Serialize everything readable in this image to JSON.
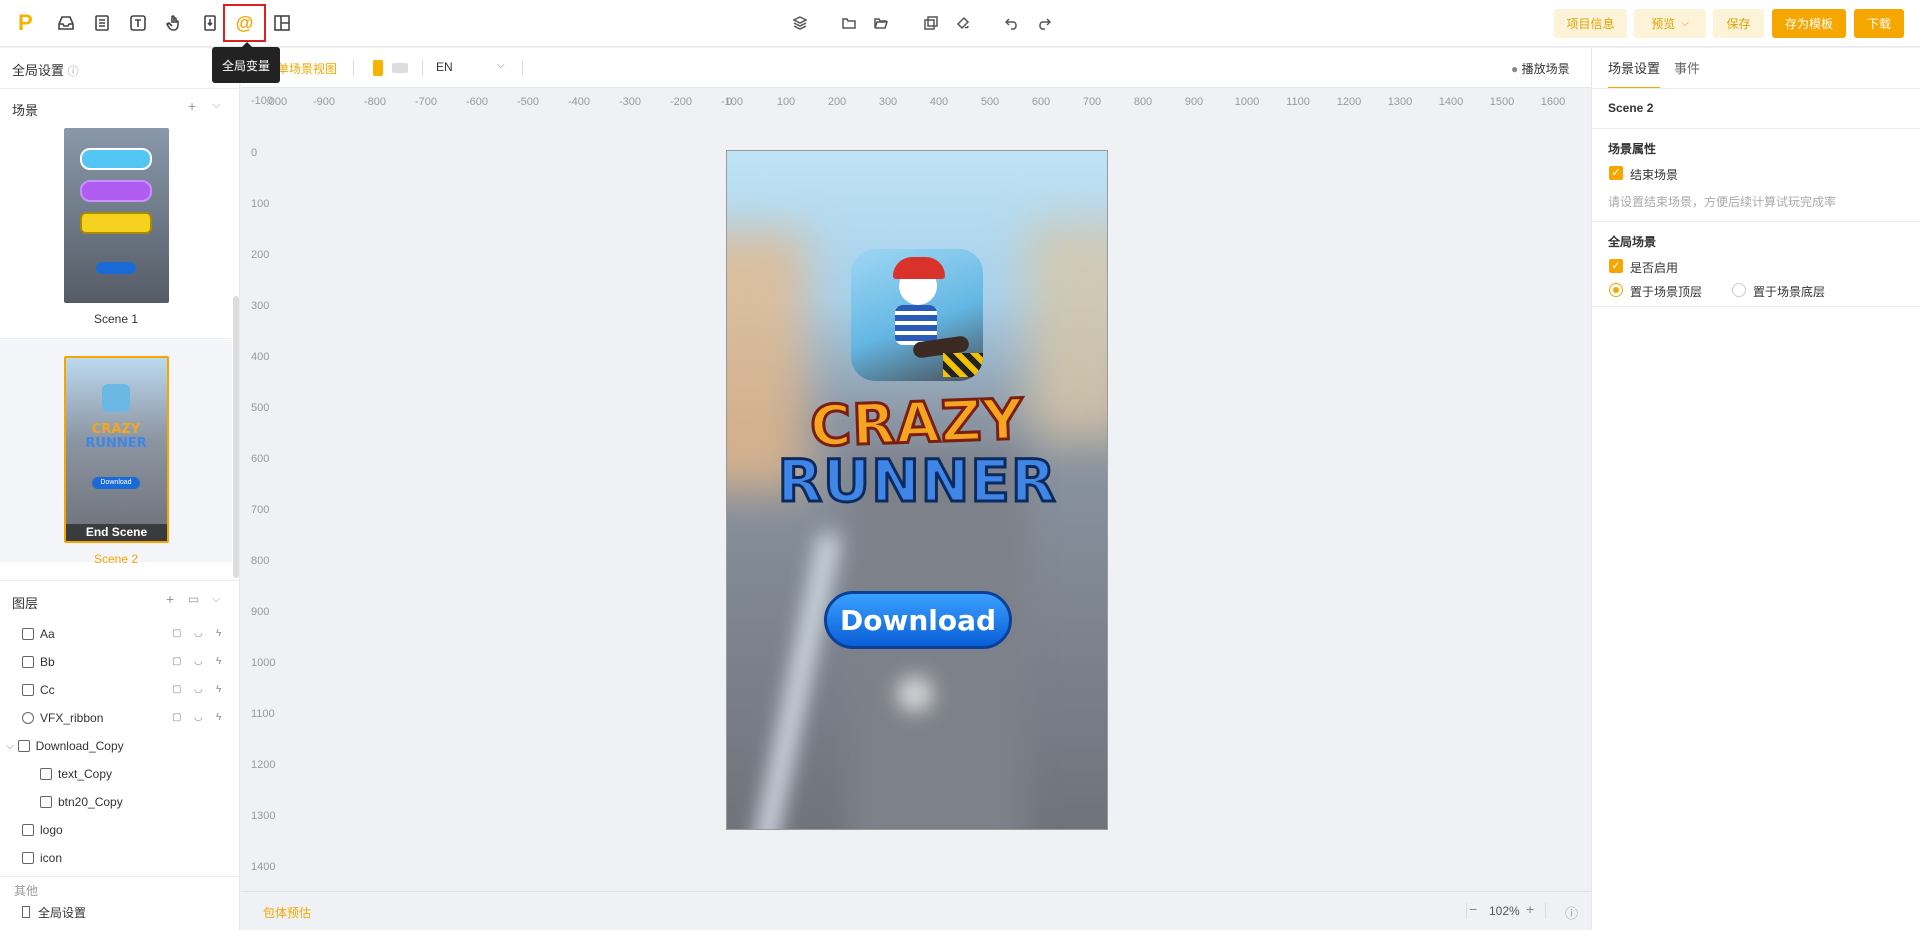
{
  "topbar": {
    "logo": "P",
    "active_icon_glyph": "@",
    "tooltip": "全局变量",
    "buttons": {
      "project_info": "项目信息",
      "preview": "预览",
      "save": "保存",
      "save_template": "存为模板",
      "download": "下载"
    }
  },
  "left": {
    "global_settings": "全局设置",
    "scenes_header": "场景",
    "scenes": [
      {
        "label": "Scene 1"
      },
      {
        "label": "Scene 2",
        "thumb_tag": "End Scene",
        "thumb_btn": "Download"
      }
    ],
    "layers_header": "图层",
    "layers": [
      {
        "name": "Aa"
      },
      {
        "name": "Bb"
      },
      {
        "name": "Cc"
      },
      {
        "name": "VFX_ribbon"
      },
      {
        "name": "Download_Copy"
      },
      {
        "name": "text_Copy"
      },
      {
        "name": "btn20_Copy"
      },
      {
        "name": "logo"
      },
      {
        "name": "icon"
      }
    ],
    "other_header": "其他",
    "other_item": "全局设置"
  },
  "subbar": {
    "single_scene_view": "单场景视图",
    "language": "EN",
    "play_scene": "播放场景"
  },
  "ruler": {
    "h": [
      "-1000",
      "-900",
      "-800",
      "-700",
      "-600",
      "-500",
      "-400",
      "-300",
      "-200",
      "-100",
      "0",
      "100",
      "200",
      "300",
      "400",
      "500",
      "600",
      "700",
      "800",
      "900",
      "1000",
      "1100",
      "1200",
      "1300",
      "1400",
      "1500",
      "1600"
    ],
    "v": [
      "-100",
      "0",
      "100",
      "200",
      "300",
      "400",
      "500",
      "600",
      "700",
      "800",
      "900",
      "1000",
      "1100",
      "1200",
      "1300",
      "1400"
    ]
  },
  "canvas": {
    "title_line1": "CRAZY",
    "title_line2": "RUNNER",
    "download_btn": "Download"
  },
  "bottom": {
    "package_estimate": "包体预估",
    "zoom": "102%"
  },
  "right": {
    "tabs": [
      "场景设置",
      "事件"
    ],
    "scene_name": "Scene 2",
    "scene_props_title": "场景属性",
    "end_scene_label": "结束场景",
    "end_scene_hint": "请设置结束场景，方便后续计算试玩完成率",
    "global_scene_title": "全局场景",
    "enable_label": "是否启用",
    "top_layer": "置于场景顶层",
    "bottom_layer": "置于场景底层"
  }
}
